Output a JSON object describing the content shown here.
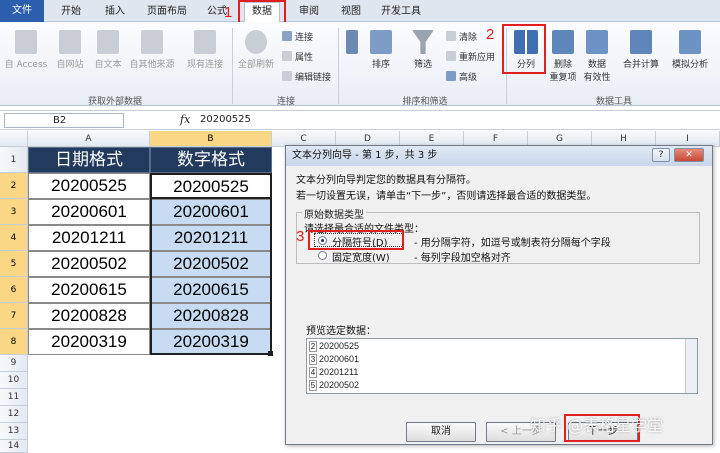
{
  "tabs": [
    "文件",
    "开始",
    "插入",
    "页面布局",
    "公式",
    "数据",
    "审阅",
    "视图",
    "开发工具"
  ],
  "ribbon": {
    "external": {
      "access": "自 Access",
      "web": "自网站",
      "text": "自文本",
      "other": "自其他来源",
      "existing": "现有连接",
      "group": "获取外部数据"
    },
    "connections": {
      "refresh": "全部刷新",
      "conn": "连接",
      "props": "属性",
      "edit": "编辑链接",
      "group": "连接"
    },
    "sort": {
      "sort": "排序",
      "filter": "筛选",
      "clear": "清除",
      "reapply": "重新应用",
      "advanced": "高级",
      "group": "排序和筛选"
    },
    "tools": {
      "split_l1": "分列",
      "remove_l1": "删除",
      "remove_l2": "重复项",
      "validate_l1": "数据",
      "validate_l2": "有效性",
      "consolidate": "合并计算",
      "whatif": "模拟分析",
      "group": "数据工具"
    }
  },
  "annotations": {
    "n1": "1",
    "n2": "2",
    "n3": "3"
  },
  "formula_bar": {
    "name_box": "B2",
    "fx": "fx",
    "value": "20200525"
  },
  "grid": {
    "columns": [
      "A",
      "B",
      "C",
      "D",
      "E",
      "F",
      "G",
      "H",
      "I"
    ],
    "rows": [
      "1",
      "2",
      "3",
      "4",
      "5",
      "6",
      "7",
      "8",
      "9",
      "10",
      "11",
      "12",
      "13",
      "14"
    ],
    "header_a": "日期格式",
    "header_b": "数字格式",
    "values_a": [
      "20200525",
      "20200601",
      "20201211",
      "20200502",
      "20200615",
      "20200828",
      "20200319"
    ],
    "values_b": [
      "20200525",
      "20200601",
      "20201211",
      "20200502",
      "20200615",
      "20200828",
      "20200319"
    ]
  },
  "dialog": {
    "title": "文本分列向导 - 第 1 步，共 3 步",
    "help": "?",
    "close": "✕",
    "line1": "文本分列向导判定您的数据具有分隔符。",
    "line2": "若一切设置无误，请单击“下一步”，否则请选择最合适的数据类型。",
    "group_title": "原始数据类型",
    "prompt": "请选择最合适的文件类型：",
    "opt1_label": "分隔符号(D)",
    "opt1_desc": "- 用分隔字符，如逗号或制表符分隔每个字段",
    "opt2_label": "固定宽度(W)",
    "opt2_desc": "- 每列字段加空格对齐",
    "preview_label": "预览选定数据：",
    "preview_rows": [
      "20200525",
      "20200601",
      "20201211",
      "20200502"
    ],
    "preview_nums": [
      "2",
      "3",
      "4",
      "5"
    ],
    "cancel": "取消",
    "back": "< 上一步",
    "next": "下一步"
  },
  "watermark": "知乎 @表格星学堂"
}
